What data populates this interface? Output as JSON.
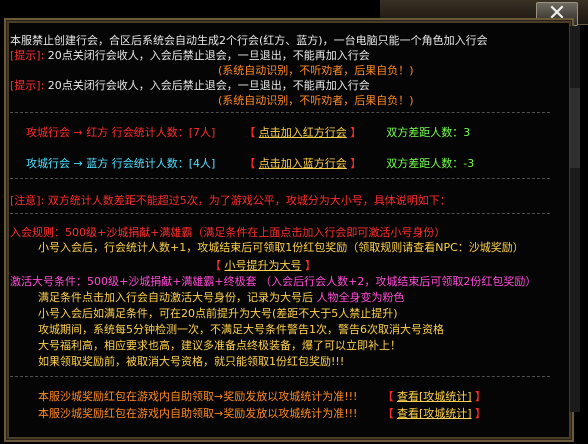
{
  "window": {
    "close_glyph": "✕"
  },
  "lines": {
    "l1": "本服禁止创建行会，合区后系统会自动生成2个行会(红方、蓝方)，一台电脑只能一个角色加入行会",
    "l2_prefix": "[提示]:",
    "l2_text": "20点关闭行会收人，入会后禁止退会，一旦退出，不能再加入行会",
    "l3": "(系统自动识别，不听劝者，后果自负！)",
    "l4_prefix": "[提示]:",
    "l4_text": "20点关闭行会收人，入会后禁止退会，一旦退出，不能再加入行会",
    "l5": "(系统自动识别，不听劝者，后果自负！)",
    "red_row_left": "攻城行会 → 红方 行会统计人数：[7人]",
    "red_row_link_l": "【",
    "red_row_link": "点击加入红方行会",
    "red_row_link_r": "】",
    "red_row_diff": "双方差距人数：3",
    "blue_row_left": "攻城行会 → 蓝方 行会统计人数：[4人]",
    "blue_row_link_l": "【",
    "blue_row_link": "点击加入蓝方行会",
    "blue_row_link_r": "】",
    "blue_row_diff": "双方差距人数：-3",
    "note": "[注意]: 双方统计人数差距不能超过5次，为了游戏公平，攻城分为大小号，具体说明如下：",
    "rule1": "入会规则：500级+沙城捐献+满雄霸（满足条件在上面点击加入行会即可激活小号身份）",
    "rule2": "小号入会后，行会统计人数+1，攻城结束后可领取1份红包奖励（领取规则请查看NPC：沙城奖励）",
    "upgrade_l": "【",
    "upgrade": "小号提升为大号",
    "upgrade_r": "】",
    "big1": "激活大号条件：500级+沙城捐献+满雄霸+终极套 （入会后行会人数+2，攻城结束后可领取2份红包奖励）",
    "big2a": "满足条件点击加入行会自动激活大号身份，记录为大号后",
    "big2b": "人物全身变为粉色",
    "big3": "小号入会后如满足条件，可在20点前提升为大号(差距不大于5人禁止提升)",
    "big4": "攻城期间，系统每5分钟检测一次，不满足大号条件警告1次，警告6次取消大号资格",
    "big5": "大号福利高，相应要求也高，建议多准备点终极装备，爆了可以立即补上！",
    "big6": "如果领取奖励前，被取消大号资格，就只能领取1份红包奖励!!!",
    "foot1": "本服沙城奖励红包在游戏内自助领取→奖励发放以攻城统计为准!!!",
    "foot1_l": "【",
    "foot1_link": "查看[攻城统计]",
    "foot1_r": "】",
    "foot2": "本服沙城奖励红包在游戏内自助领取→奖励发放以攻城统计为准!!!",
    "foot2_l": "【",
    "foot2_link": "查看[攻城统计]",
    "foot2_r": "】"
  }
}
